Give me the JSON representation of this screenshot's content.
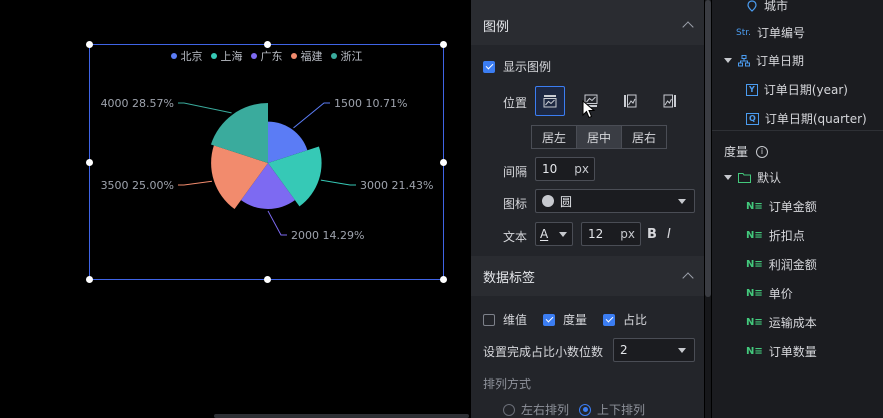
{
  "chart_data": {
    "type": "pie",
    "variant": "rose",
    "categories": [
      "北京",
      "上海",
      "广东",
      "福建",
      "浙江"
    ],
    "values": [
      1500,
      3000,
      2000,
      3500,
      4000
    ],
    "percent_labels": [
      "1500 10.71%",
      "3000 21.43%",
      "2000 14.29%",
      "3500 25.00%",
      "4000 28.57%"
    ],
    "colors": [
      "#5b7cf5",
      "#36c9b6",
      "#7d6af2",
      "#f28b6d",
      "#3aab9d"
    ],
    "legend_position": "top-center"
  },
  "panel": {
    "legend_section": {
      "title": "图例",
      "show_legend_label": "显示图例",
      "show_legend_checked": true,
      "position_label": "位置",
      "align_options": [
        "居左",
        "居中",
        "居右"
      ],
      "align_selected": "居中",
      "gap_label": "间隔",
      "gap_value": "10",
      "gap_unit": "px",
      "icon_label": "图标",
      "icon_value": "圆",
      "text_label": "文本",
      "font_letter": "A",
      "font_size": "12",
      "font_unit": "px",
      "bold": "B",
      "italic": "I"
    },
    "data_label_section": {
      "title": "数据标签",
      "dimension_label": "维值",
      "dimension_checked": false,
      "measure_label": "度量",
      "measure_checked": true,
      "ratio_label": "占比",
      "ratio_checked": true,
      "decimal_label": "设置完成占比小数位数",
      "decimal_value": "2",
      "arrange_label": "排列方式",
      "arrange_lr": "左右排列",
      "arrange_tb": "上下排列"
    }
  },
  "tree": {
    "city": "城市",
    "order_no_badge": "Str.",
    "order_no": "订单编号",
    "order_date": "订单日期",
    "order_date_year": "订单日期(year)",
    "order_date_quarter": "订单日期(quarter)",
    "year_badge": "Y",
    "quarter_badge": "Q",
    "measures_title": "度量",
    "default_folder": "默认",
    "measure_badge": "N≡",
    "measures": [
      "订单金额",
      "折扣点",
      "利润金额",
      "单价",
      "运输成本",
      "订单数量"
    ]
  }
}
